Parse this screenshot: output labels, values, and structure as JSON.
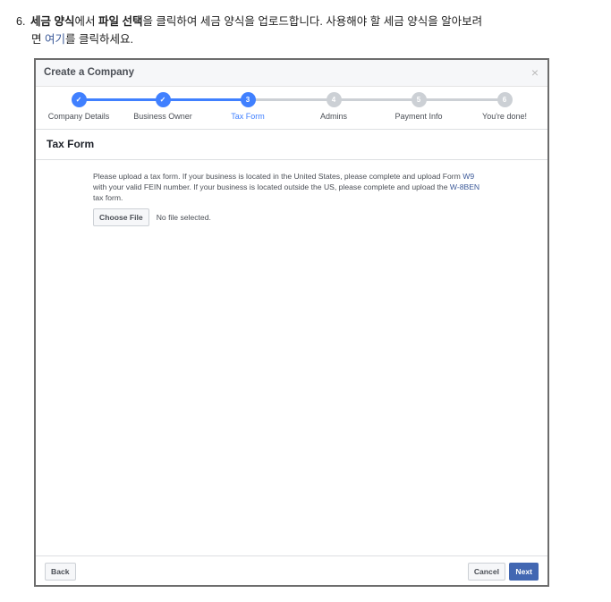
{
  "instruction": {
    "number": "6.",
    "part1_bold": "세금 양식",
    "part2": "에서 ",
    "part3_bold": "파일 선택",
    "part4": "을 클릭하여 세금 양식을 업로드합니다. 사용해야 할 세금 양식을 알아보려",
    "part5": "면 ",
    "link": "여기",
    "part6": "를 클릭하세요."
  },
  "dialog": {
    "title": "Create a Company",
    "close_icon": "×",
    "steps": [
      {
        "label": "Company Details",
        "marker": "✓",
        "state": "done"
      },
      {
        "label": "Business Owner",
        "marker": "✓",
        "state": "done"
      },
      {
        "label": "Tax Form",
        "marker": "3",
        "state": "active"
      },
      {
        "label": "Admins",
        "marker": "4",
        "state": "todo"
      },
      {
        "label": "Payment Info",
        "marker": "5",
        "state": "todo"
      },
      {
        "label": "You're done!",
        "marker": "6",
        "state": "todo"
      }
    ],
    "section_title": "Tax Form",
    "body": {
      "t1": "Please upload a tax form. If your business is located in the United States, please complete and upload Form ",
      "w9": "W9",
      "t2": " with your valid FEIN number. If your business is located outside the US, please complete and upload the ",
      "w8": "W-8BEN",
      "t3": " tax form."
    },
    "choose_file": "Choose File",
    "no_file": "No file selected.",
    "back": "Back",
    "cancel": "Cancel",
    "next": "Next"
  },
  "colors": {
    "accent": "#4267b2",
    "active_step": "#4080ff",
    "inactive_step": "#ccd0d5"
  }
}
